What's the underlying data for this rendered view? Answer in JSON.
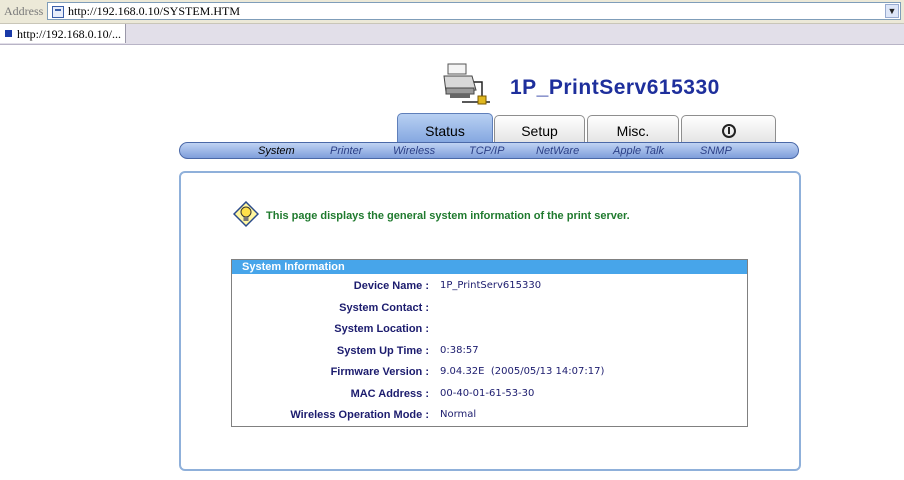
{
  "browser": {
    "address_label": "Address",
    "url": "http://192.168.0.10/SYSTEM.HTM",
    "tab_title": "http://192.168.0.10/..."
  },
  "header": {
    "device_title": "1P_PrintServ615330",
    "printer_icon": "printer-network-icon"
  },
  "main_tabs": [
    {
      "label": "Status",
      "active": true
    },
    {
      "label": "Setup",
      "active": false
    },
    {
      "label": "Misc.",
      "active": false
    },
    {
      "label": "",
      "icon": "info-icon",
      "active": false
    }
  ],
  "sub_nav": [
    {
      "label": "System",
      "active": true
    },
    {
      "label": "Printer"
    },
    {
      "label": "Wireless"
    },
    {
      "label": "TCP/IP"
    },
    {
      "label": "NetWare"
    },
    {
      "label": "Apple Talk"
    },
    {
      "label": "SNMP"
    }
  ],
  "intro_text": "This page displays the general system information of the print server.",
  "system_info": {
    "heading": "System Information",
    "rows": [
      {
        "label": "Device Name :",
        "value": "1P_PrintServ615330"
      },
      {
        "label": "System Contact :",
        "value": ""
      },
      {
        "label": "System Location :",
        "value": ""
      },
      {
        "label": "System Up Time :",
        "value": "0:38:57"
      },
      {
        "label": "Firmware Version :",
        "value": "9.04.32E  (2005/05/13 14:07:17)"
      },
      {
        "label": "MAC Address :",
        "value": "00-40-01-61-53-30"
      },
      {
        "label": "Wireless Operation Mode :",
        "value": "Normal"
      }
    ]
  },
  "colors": {
    "title_blue": "#1e2f9c",
    "intro_green": "#1f7a2e",
    "table_header": "#47a5ea"
  }
}
